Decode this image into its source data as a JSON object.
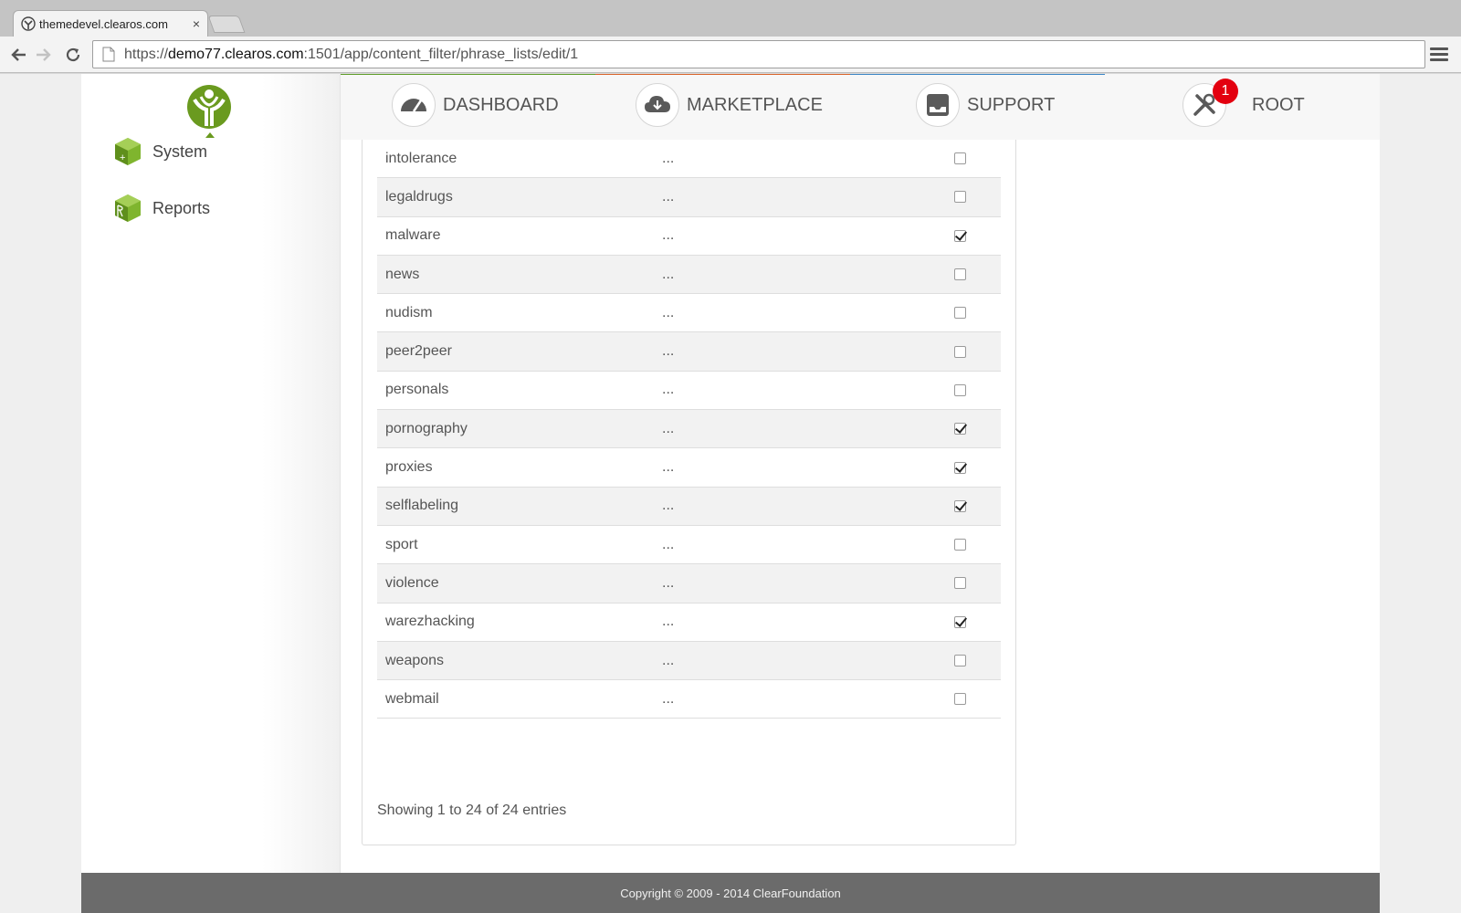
{
  "browser": {
    "tab_title": "themedevel.clearos.com",
    "tab_close": "×",
    "url_scheme": "https://",
    "url_host": "demo77.clearos.com",
    "url_path": ":1501/app/content_filter/phrase_lists/edit/1"
  },
  "sidebar": {
    "items": [
      {
        "label": "System",
        "icon": "system-cube-icon"
      },
      {
        "label": "Reports",
        "icon": "reports-cube-icon"
      }
    ]
  },
  "topnav": {
    "items": [
      {
        "label": "DASHBOARD",
        "icon": "gauge-icon"
      },
      {
        "label": "MARKETPLACE",
        "icon": "cloud-download-icon"
      },
      {
        "label": "SUPPORT",
        "icon": "inbox-icon"
      },
      {
        "label": "ROOT",
        "icon": "tools-icon",
        "badge": "1"
      }
    ],
    "accent_colors": [
      "#5f9e2a",
      "#d9642a",
      "#3b86c6"
    ]
  },
  "phrase_list": {
    "rows": [
      {
        "name": "intolerance",
        "description": "...",
        "checked": false
      },
      {
        "name": "legaldrugs",
        "description": "...",
        "checked": false
      },
      {
        "name": "malware",
        "description": "...",
        "checked": true
      },
      {
        "name": "news",
        "description": "...",
        "checked": false
      },
      {
        "name": "nudism",
        "description": "...",
        "checked": false
      },
      {
        "name": "peer2peer",
        "description": "...",
        "checked": false
      },
      {
        "name": "personals",
        "description": "...",
        "checked": false
      },
      {
        "name": "pornography",
        "description": "...",
        "checked": true
      },
      {
        "name": "proxies",
        "description": "...",
        "checked": true
      },
      {
        "name": "selflabeling",
        "description": "...",
        "checked": true
      },
      {
        "name": "sport",
        "description": "...",
        "checked": false
      },
      {
        "name": "violence",
        "description": "...",
        "checked": false
      },
      {
        "name": "warezhacking",
        "description": "...",
        "checked": true
      },
      {
        "name": "weapons",
        "description": "...",
        "checked": false
      },
      {
        "name": "webmail",
        "description": "...",
        "checked": false
      }
    ],
    "entries_text": "Showing 1 to 24 of 24 entries"
  },
  "footer": {
    "copyright": "Copyright © 2009 - 2014 ClearFoundation"
  }
}
